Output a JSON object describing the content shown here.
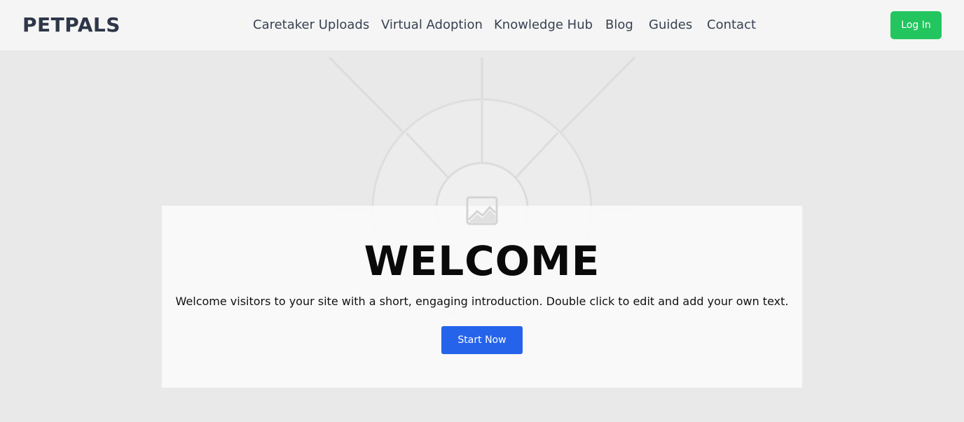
{
  "header": {
    "logo": "PETPALS",
    "nav": [
      {
        "label": "Caretaker Uploads"
      },
      {
        "label": "Virtual Adoption"
      },
      {
        "label": "Knowledge Hub"
      },
      {
        "label": "Blog"
      },
      {
        "label": "Guides"
      },
      {
        "label": "Contact"
      }
    ],
    "login_label": "Log In"
  },
  "hero": {
    "background_icon": "image-placeholder-icon",
    "title": "WELCOME",
    "text": "Welcome visitors to your site with a short, engaging introduction. Double click to edit and add your own text.",
    "cta_label": "Start Now"
  },
  "colors": {
    "login_button": "#22c55e",
    "cta_button": "#2563eb",
    "logo": "#2d3748",
    "header_bg": "#f5f5f5",
    "hero_bg": "#e9e9e9"
  }
}
